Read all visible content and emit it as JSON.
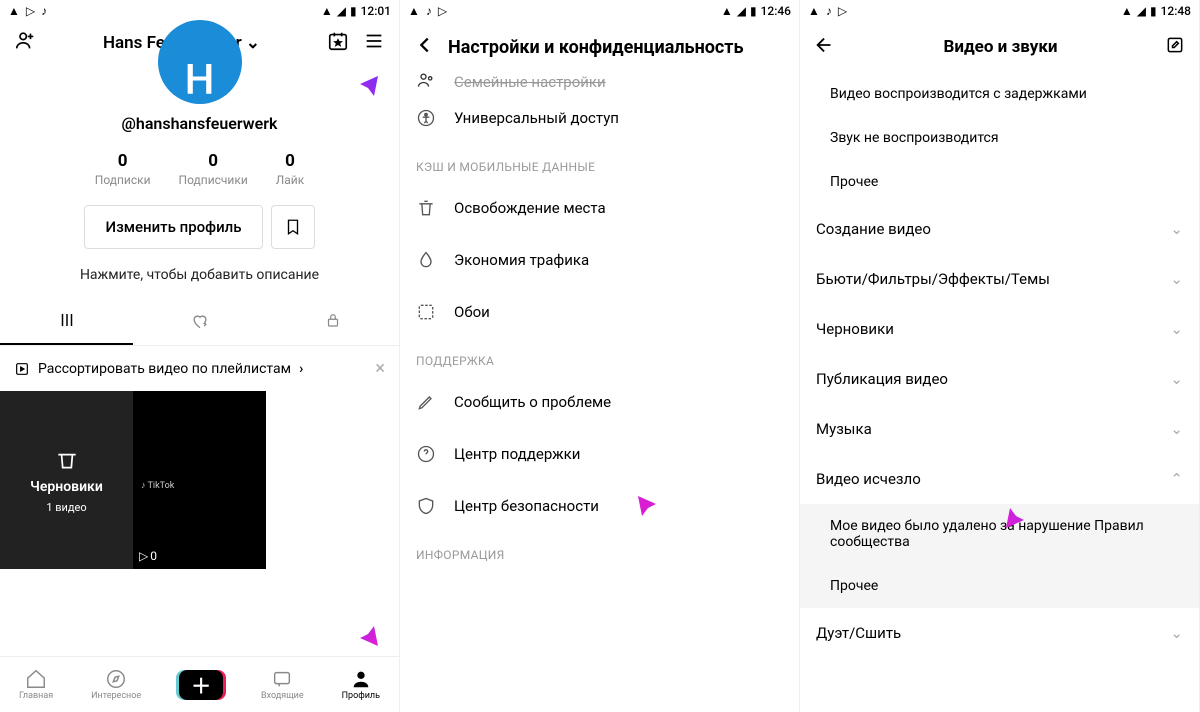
{
  "screen1": {
    "time": "12:01",
    "display_name": "Hans Feuerwerker",
    "username": "@hanshansfeuerwerk",
    "avatar_letter": "H",
    "stats": [
      {
        "num": "0",
        "label": "Подписки"
      },
      {
        "num": "0",
        "label": "Подписчики"
      },
      {
        "num": "0",
        "label": "Лайк"
      }
    ],
    "edit_label": "Изменить профиль",
    "bio_hint": "Нажмите, чтобы добавить описание",
    "sort_label": "Рассортировать видео по плейлистам",
    "draft_label": "Черновики",
    "draft_count": "1 видео",
    "video_plays": "0",
    "video_logo": "TikTok",
    "bottom": {
      "home": "Главная",
      "discover": "Интересное",
      "inbox": "Входящие",
      "profile": "Профиль"
    }
  },
  "screen2": {
    "time": "12:46",
    "title": "Настройки и конфиденциальность",
    "cutoff_row": "Семейные настройки",
    "rows_top": [
      "Универсальный доступ"
    ],
    "section_cache": "КЭШ И МОБИЛЬНЫЕ ДАННЫЕ",
    "rows_cache": [
      "Освобождение места",
      "Экономия трафика",
      "Обои"
    ],
    "section_support": "ПОДДЕРЖКА",
    "rows_support": [
      "Сообщить о проблеме",
      "Центр поддержки",
      "Центр безопасности"
    ],
    "section_info": "ИНФОРМАЦИЯ"
  },
  "screen3": {
    "time": "12:48",
    "title": "Видео и звуки",
    "sub_top": [
      "Видео воспроизводится с задержками",
      "Звук не воспроизводится",
      "Прочее"
    ],
    "menu": [
      "Создание видео",
      "Бьюти/Фильтры/Эффекты/Темы",
      "Черновики",
      "Публикация видео",
      "Музыка"
    ],
    "expanded_label": "Видео исчезло",
    "expanded_sub": [
      "Мое видео было удалено за нарушение Правил сообщества",
      "Прочее"
    ],
    "menu_bottom": "Дуэт/Сшить"
  }
}
